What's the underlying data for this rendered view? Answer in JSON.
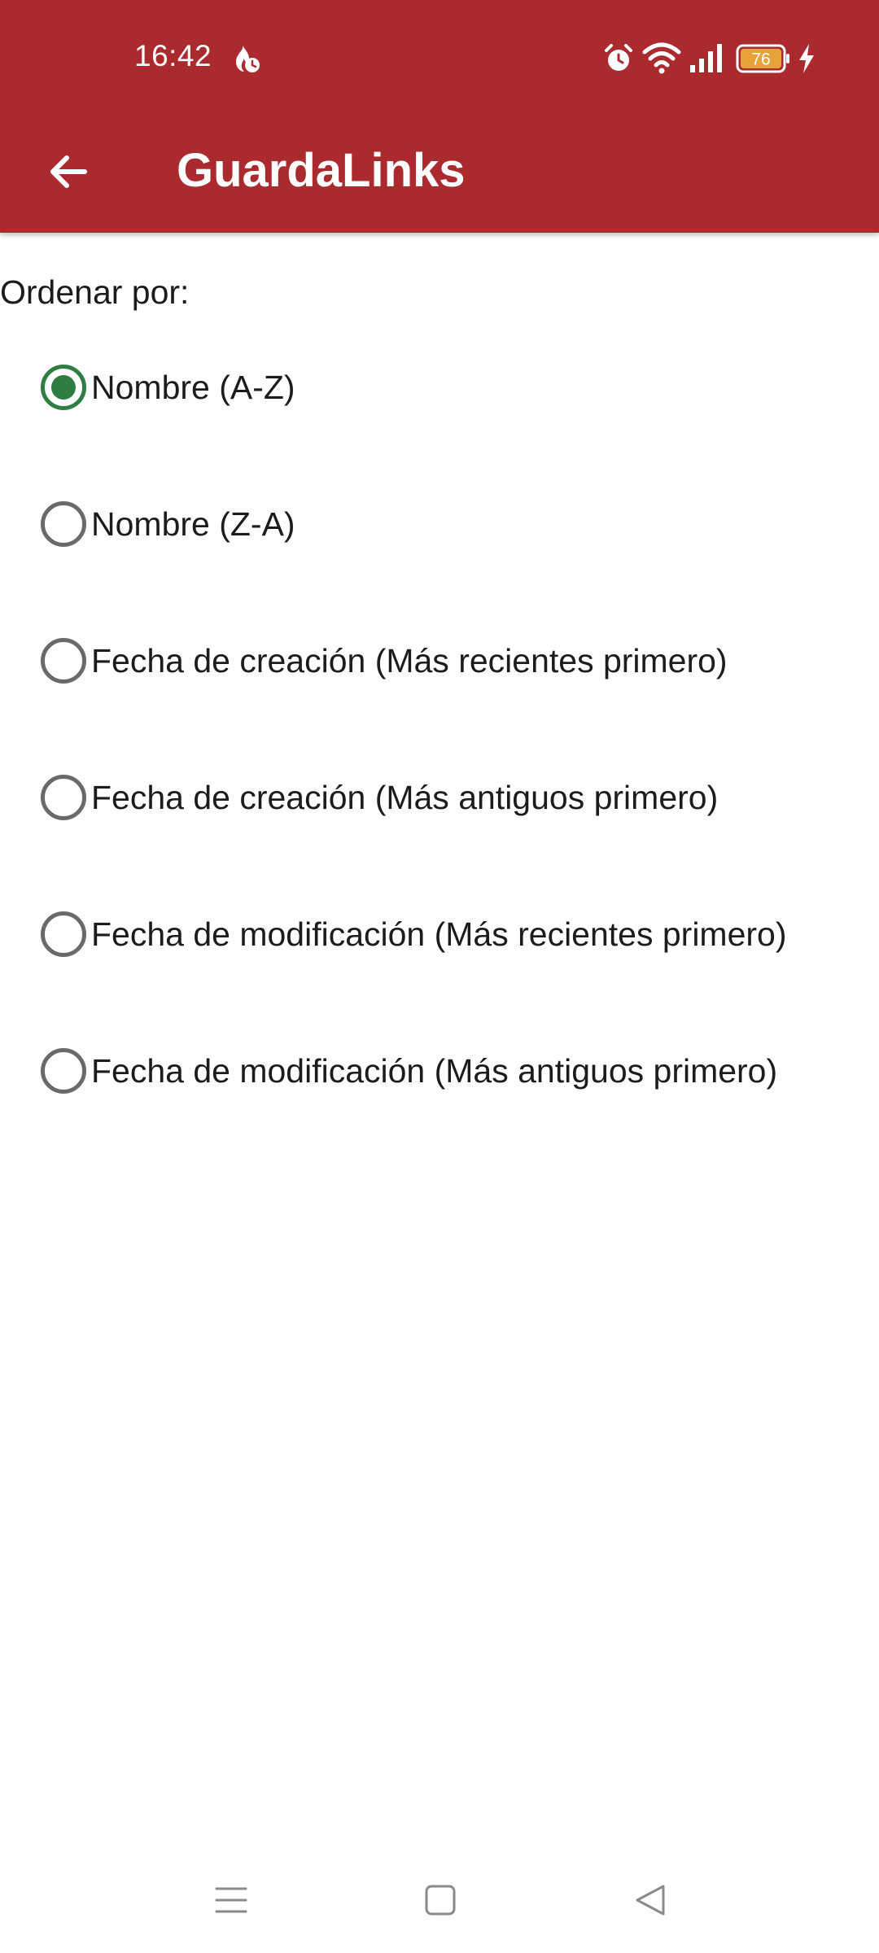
{
  "status_bar": {
    "time": "16:42",
    "battery_level": "76",
    "icons": [
      "flame-clock-icon",
      "alarm-icon",
      "wifi-icon",
      "signal-icon",
      "battery-icon",
      "charging-bolt-icon"
    ]
  },
  "app_bar": {
    "back_icon": "arrow-back-icon",
    "title": "GuardaLinks"
  },
  "sort": {
    "label": "Ordenar por:",
    "selected_index": 0,
    "options": [
      {
        "label": "Nombre (A-Z)",
        "checked": true
      },
      {
        "label": "Nombre (Z-A)",
        "checked": false
      },
      {
        "label": "Fecha de creación (Más recientes primero)",
        "checked": false
      },
      {
        "label": "Fecha de creación (Más antiguos primero)",
        "checked": false
      },
      {
        "label": "Fecha de modificación (Más recientes primero)",
        "checked": false
      },
      {
        "label": "Fecha de modificación (Más antiguos primero)",
        "checked": false
      }
    ]
  },
  "nav_bar": {
    "icons": [
      "menu-icon",
      "home-square-icon",
      "back-triangle-icon"
    ]
  },
  "colors": {
    "app_bar": "#aa2a2e",
    "radio_checked": "#2e7d43",
    "radio_unchecked": "#6a6a6a",
    "text": "#1c1c1c"
  }
}
